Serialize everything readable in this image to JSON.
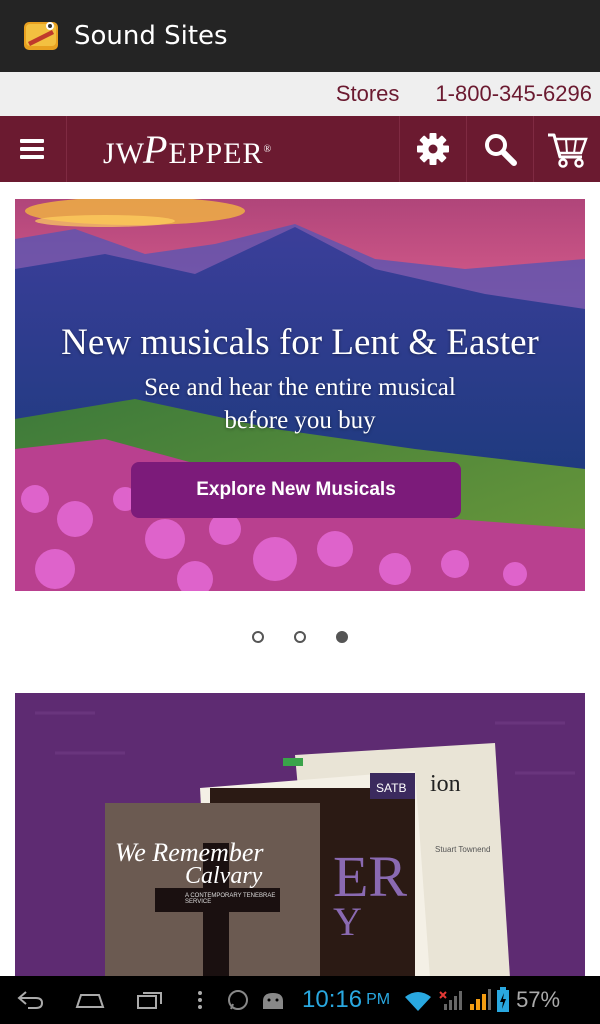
{
  "app": {
    "title": "Sound Sites"
  },
  "toplinks": {
    "stores": "Stores",
    "phone": "1-800-345-6296"
  },
  "nav": {
    "logo_prefix": "JW",
    "logo_big": "P",
    "logo_rest": "EPPER",
    "logo_mark": "®"
  },
  "hero": {
    "title": "New musicals for Lent & Easter",
    "subtitle_line1": "See and hear the entire musical",
    "subtitle_line2": "before you buy",
    "button": "Explore New Musicals"
  },
  "carousel": {
    "count": 3,
    "active_index": 2
  },
  "promo": {
    "book1_title": "We Remember",
    "book1_title2": "Calvary",
    "book1_sub": "A CONTEMPORARY TENEBRAE SERVICE",
    "book2_badge": "SATB",
    "book2_letters": "ER",
    "book2_letters2": "Y",
    "book3_text": "ion",
    "book3_author": "Stuart Townend"
  },
  "status": {
    "time": "10:16",
    "ampm": "PM",
    "battery": "57%"
  },
  "colors": {
    "brand": "#6b1a30",
    "button": "#7c1b7a",
    "status": "#29a8e0"
  }
}
